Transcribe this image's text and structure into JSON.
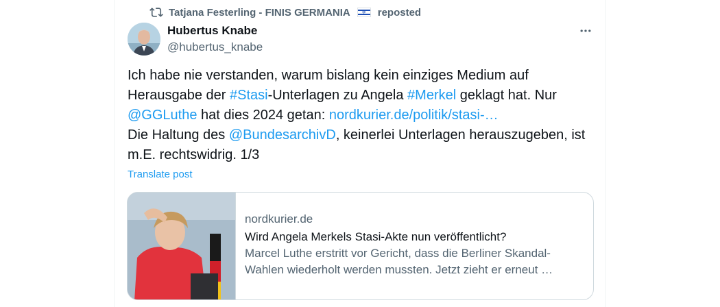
{
  "repost": {
    "prefix": "Tatjana Festerling - FINIS GERMANIA",
    "suffix": "reposted",
    "icon": "repost-icon",
    "flag_icon": "israel-flag-icon"
  },
  "author": {
    "name": "Hubertus Knabe",
    "handle": "@hubertus_knabe",
    "avatar_icon": "avatar"
  },
  "more_icon": "more-options-icon",
  "tweet": {
    "t1": "Ich habe nie verstanden, warum bislang kein einziges Medium auf Herausgabe der ",
    "tag_stasi": "#Stasi",
    "t2": "-Unterlagen zu Angela ",
    "tag_merkel": "#Merkel",
    "t3": " geklagt hat. Nur ",
    "mention_luthe": "@GGLuthe",
    "t4": " hat dies 2024 getan: ",
    "url": "nordkurier.de/politik/stasi-…",
    "t5": "Die Haltung des ",
    "mention_archiv": "@BundesarchivD",
    "t6": ", keinerlei Unterlagen herauszugeben, ist m.E. rechtswidrig. 1/3"
  },
  "translate_label": "Translate post",
  "card": {
    "domain": "nordkurier.de",
    "title": "Wird Angela Merkels Stasi-Akte nun veröffentlicht?",
    "description": "Marcel Luthe erstritt vor Gericht, dass die Berliner Skandal-Wahlen wiederholt werden mussten. Jetzt zieht er erneut …"
  },
  "colors": {
    "link": "#1d9bf0",
    "secondary_text": "#536471",
    "primary_text": "#0f1419",
    "border": "#cfd9de"
  }
}
